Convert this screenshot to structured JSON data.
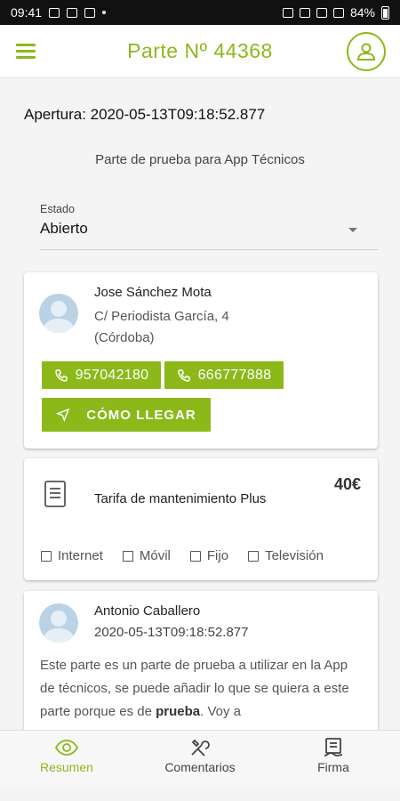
{
  "status_bar": {
    "time": "09:41",
    "battery": "84%"
  },
  "app_bar": {
    "title": "Parte Nº 44368",
    "menu_icon": "hamburger-icon",
    "profile_icon": "user-icon"
  },
  "apertura": "Apertura: 2020-05-13T09:18:52.877",
  "descripcion": "Parte de prueba para App Técnicos",
  "estado": {
    "label": "Estado",
    "value": "Abierto"
  },
  "client": {
    "name": "Jose Sánchez Mota",
    "address": "C/ Periodista García, 4 (Córdoba)",
    "phones": [
      "957042180",
      "666777888"
    ],
    "route_label": "CÓMO LLEGAR"
  },
  "tarifa": {
    "name": "Tarifa de mantenimiento Plus",
    "price": "40€",
    "services": [
      "Internet",
      "Móvil",
      "Fijo",
      "Televisión"
    ]
  },
  "comment": {
    "author": "Antonio Caballero",
    "date": "2020-05-13T09:18:52.877",
    "text_before": "Este parte es un parte de prueba a utilizar en la App de técnicos, se puede añadir lo que se quiera a este parte porque es de ",
    "text_bold": "prueba",
    "text_after": ". Voy a"
  },
  "bottom_nav": {
    "items": [
      {
        "label": "Resumen",
        "icon": "eye-icon"
      },
      {
        "label": "Comentarios",
        "icon": "tools-icon"
      },
      {
        "label": "Firma",
        "icon": "signature-icon"
      }
    ]
  },
  "colors": {
    "accent": "#8cb81a"
  }
}
